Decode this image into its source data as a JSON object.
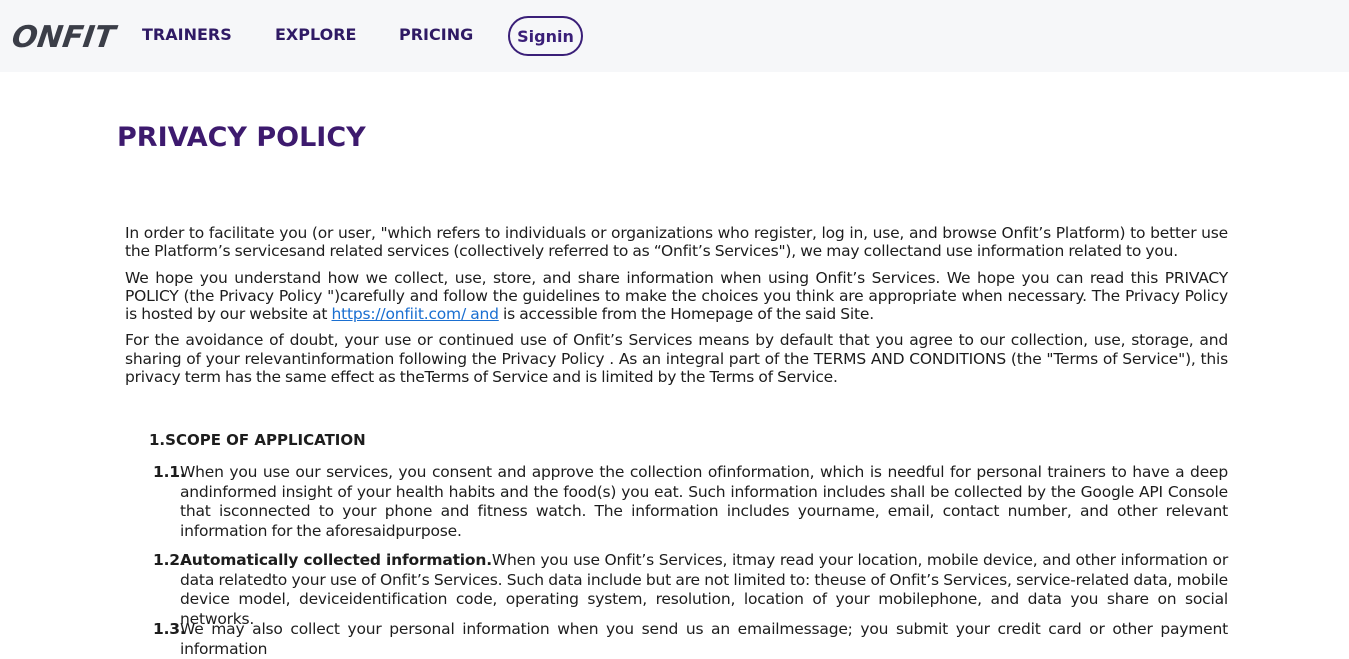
{
  "nav": {
    "logo": "ONFIT",
    "links": [
      "TRAINERS",
      "EXPLORE",
      "PRICING"
    ],
    "signin": "Signin"
  },
  "page": {
    "title": "PRIVACY POLICY"
  },
  "intro": {
    "p1": "In order to facilitate you (or user, \"which refers to individuals or organizations who register, log in, use, and browse Onfit’s Platform) to better use the Platform’s servicesand related services (collectively referred to as “Onfit’s Services\"), we may collectand use information related to you.",
    "p2_before": "We hope you understand how we collect, use, store, and share information when using Onfit’s Services. We hope you can read this PRIVACY POLICY (the Privacy Policy \")carefully and follow the guidelines to make the choices you think are appropriate when necessary. The Privacy Policy is hosted by our website at ",
    "p2_link": "https://onfiit.com/ and",
    "p2_after": " is accessible from the Homepage of the said Site.",
    "p3": "For the avoidance of doubt, your use or continued use of Onfit’s Services means by default that you agree to our collection, use, storage, and sharing of your relevantinformation following the Privacy Policy . As an integral part of the TERMS AND CONDITIONS (the \"Terms of Service\"), this privacy term has the same effect as theTerms of Service and is limited by the Terms of Service."
  },
  "section1": {
    "heading": "1.SCOPE OF APPLICATION",
    "clauses": [
      {
        "num": "1.1.",
        "bold": "",
        "text": "When you use our services, you consent and approve the collection ofinformation, which is needful for personal trainers to have a deep andinformed insight of your health habits and the food(s) you eat. Such information includes shall be collected by the Google API Console that isconnected to your phone and fitness watch. The information includes yourname, email, contact number, and other relevant information for the aforesaidpurpose."
      },
      {
        "num": "1.2.",
        "bold": "Automatically collected information.",
        "text": "When you use Onfit’s Services, itmay read your location, mobile device, and other information or data relatedto your use of Onfit’s Services. Such data include but are not limited to: theuse of Onfit’s Services, service-related data, mobile device model, deviceidentification code, operating system, resolution, location of your mobilephone, and data you share on social networks."
      },
      {
        "num": "1.3.",
        "bold": "",
        "text": "We may also collect your personal information when you send us an emailmessage; you submit your credit card or other payment information"
      }
    ]
  }
}
